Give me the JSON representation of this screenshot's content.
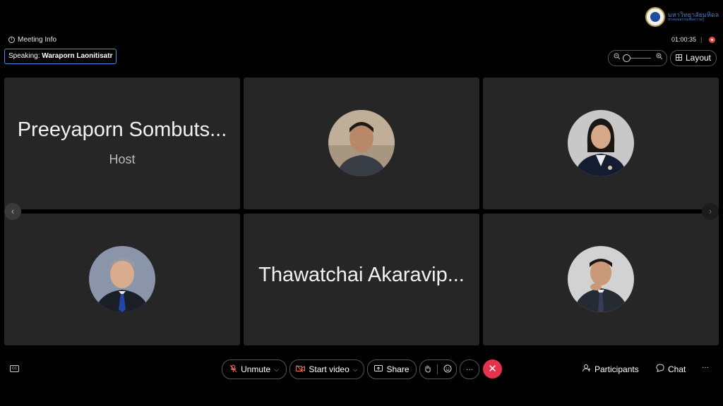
{
  "header": {
    "logo_text_line1": "มหาวิทยาลัยมหิดล",
    "logo_text_line2": "ทรงคุณธรรมเพื่อความรู้",
    "meeting_info_label": "Meeting Info",
    "speaking_prefix": "Speaking:",
    "speaking_name": "Waraporn Laonitisatr",
    "timer": "01:00:35",
    "separator": "|",
    "layout_label": "Layout"
  },
  "tiles": [
    {
      "name": "Preeyaporn Sombuts...",
      "role": "Host",
      "avatar": false
    },
    {
      "name": "",
      "role": "",
      "avatar": true
    },
    {
      "name": "",
      "role": "",
      "avatar": true
    },
    {
      "name": "",
      "role": "",
      "avatar": true
    },
    {
      "name": "Thawatchai Akaravip...",
      "role": "",
      "avatar": false
    },
    {
      "name": "",
      "role": "",
      "avatar": true
    }
  ],
  "toolbar": {
    "unmute_label": "Unmute",
    "start_video_label": "Start video",
    "share_label": "Share",
    "more_label": "···",
    "participants_label": "Participants",
    "chat_label": "Chat",
    "overflow_label": "···"
  },
  "colors": {
    "accent_blue": "#4a8fe0",
    "end_call_red": "#e5334b",
    "record_red": "#e8483b",
    "tile_bg": "#262626"
  },
  "icons": [
    "info-icon",
    "zoom-out-icon",
    "zoom-in-icon",
    "layout-grid-icon",
    "chevron-left-icon",
    "chevron-right-icon",
    "captions-icon",
    "mic-muted-icon",
    "chevron-down-icon",
    "video-off-icon",
    "share-screen-icon",
    "raise-hand-icon",
    "emoji-reaction-icon",
    "close-icon",
    "participants-icon",
    "chat-bubble-icon"
  ]
}
